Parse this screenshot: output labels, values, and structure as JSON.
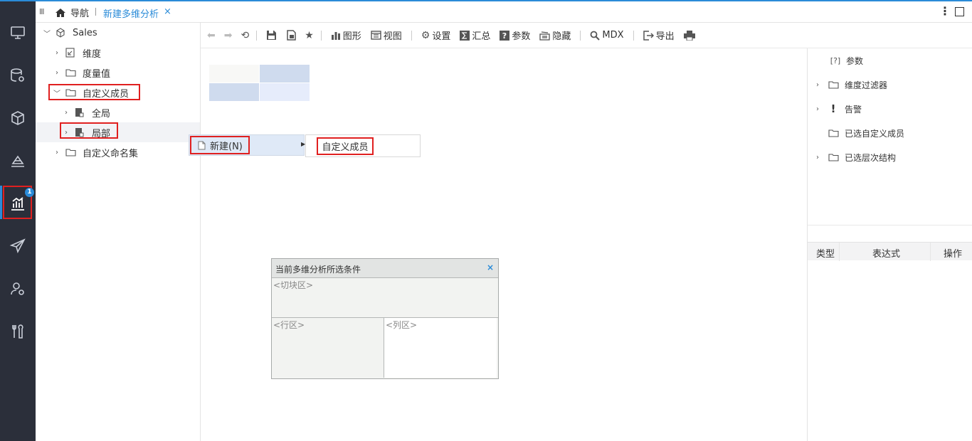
{
  "tabs": {
    "home_label": "导航",
    "active_label": "新建多维分析",
    "close_glyph": "×",
    "menu_glyph": "Ⅲ",
    "more_glyph": "⋮"
  },
  "nav": {
    "badge": "1",
    "items": [
      "monitor-icon",
      "database-gear-icon",
      "cube-icon",
      "layers-chart-icon",
      "bar-chart-icon",
      "paper-plane-icon",
      "user-gear-icon",
      "tools-icon"
    ],
    "active_index": 4
  },
  "tree": {
    "root": "Sales",
    "items": [
      {
        "label": "维度",
        "icon": "dimension-icon"
      },
      {
        "label": "度量值",
        "icon": "folder-icon"
      },
      {
        "label": "自定义成员",
        "icon": "folder-icon"
      },
      {
        "label": "全局",
        "icon": "doc-dark-icon"
      },
      {
        "label": "局部",
        "icon": "doc-dark-icon"
      },
      {
        "label": "自定义命名集",
        "icon": "folder-icon"
      }
    ]
  },
  "toolbar": {
    "chart": "图形",
    "view": "视图",
    "settings": "设置",
    "summary": "汇总",
    "params": "参数",
    "hide": "隐藏",
    "mdx": "MDX",
    "export": "导出"
  },
  "context_menu": {
    "new_label": "新建(N)",
    "submenu_item": "自定义成员"
  },
  "dialog": {
    "title": "当前多维分析所选条件",
    "close": "×",
    "slice": "<切块区>",
    "row": "<行区>",
    "col": "<列区>"
  },
  "right_panel": {
    "params_label": "参数",
    "params_icon": "[?]",
    "dim_filter": "维度过滤器",
    "alert": "告警",
    "selected_custom": "已选自定义成员",
    "selected_hierarchy": "已选层次结构",
    "col_type": "类型",
    "col_expr": "表达式",
    "col_action": "操作"
  },
  "colors": {
    "accent": "#2a8bd8",
    "nav_bg": "#2b2f3a",
    "highlight_red": "#e02020",
    "menu_bg": "#dfe9f7"
  }
}
